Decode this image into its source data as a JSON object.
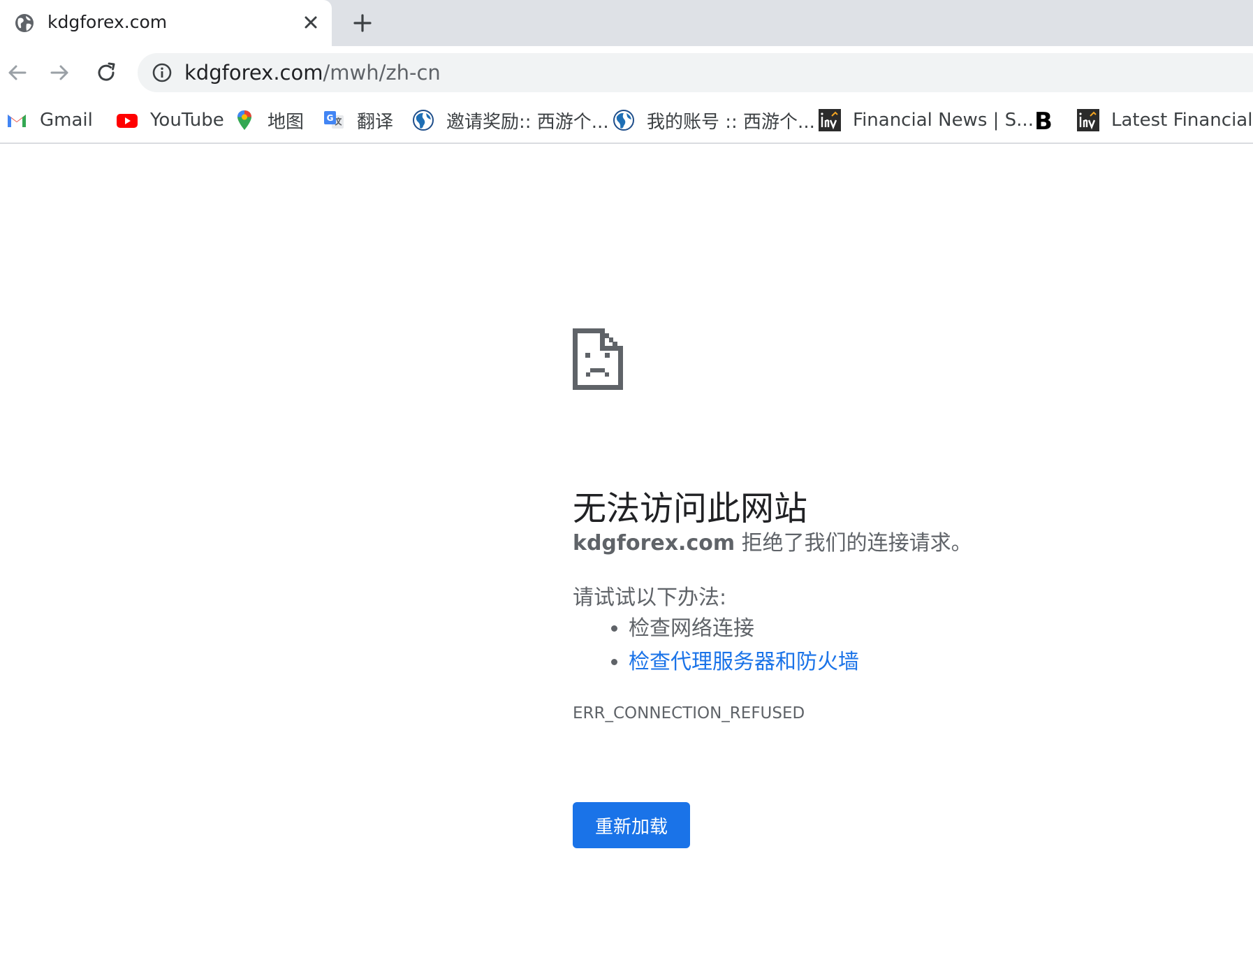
{
  "tab": {
    "title": "kdgforex.com"
  },
  "omnibox": {
    "host": "kdgforex.com",
    "path": "/mwh/zh-cn"
  },
  "bookmarks": [
    {
      "label": "Gmail",
      "icon": "gmail-icon"
    },
    {
      "label": "YouTube",
      "icon": "youtube-icon"
    },
    {
      "label": "地图",
      "icon": "maps-icon"
    },
    {
      "label": "翻译",
      "icon": "translate-icon"
    },
    {
      "label": "邀请奖励:: 西游个...",
      "icon": "site-globe-icon"
    },
    {
      "label": "我的账号 :: 西游个...",
      "icon": "site-globe-icon"
    },
    {
      "label": "Financial News | S...",
      "icon": "investing-icon"
    },
    {
      "label": "",
      "icon": "bold-b-icon"
    },
    {
      "label": "Latest Financial N",
      "icon": "investing-icon"
    }
  ],
  "error": {
    "heading": "无法访问此网站",
    "host": "kdgforex.com",
    "description": " 拒绝了我们的连接请求。",
    "try_label": "请试试以下办法:",
    "suggestions": [
      "检查网络连接",
      "检查代理服务器和防火墙"
    ],
    "code": "ERR_CONNECTION_REFUSED",
    "reload_label": "重新加载"
  },
  "colors": {
    "accent": "#1a73e8",
    "tabstrip": "#dee1e6",
    "omnibox": "#f1f3f4"
  }
}
